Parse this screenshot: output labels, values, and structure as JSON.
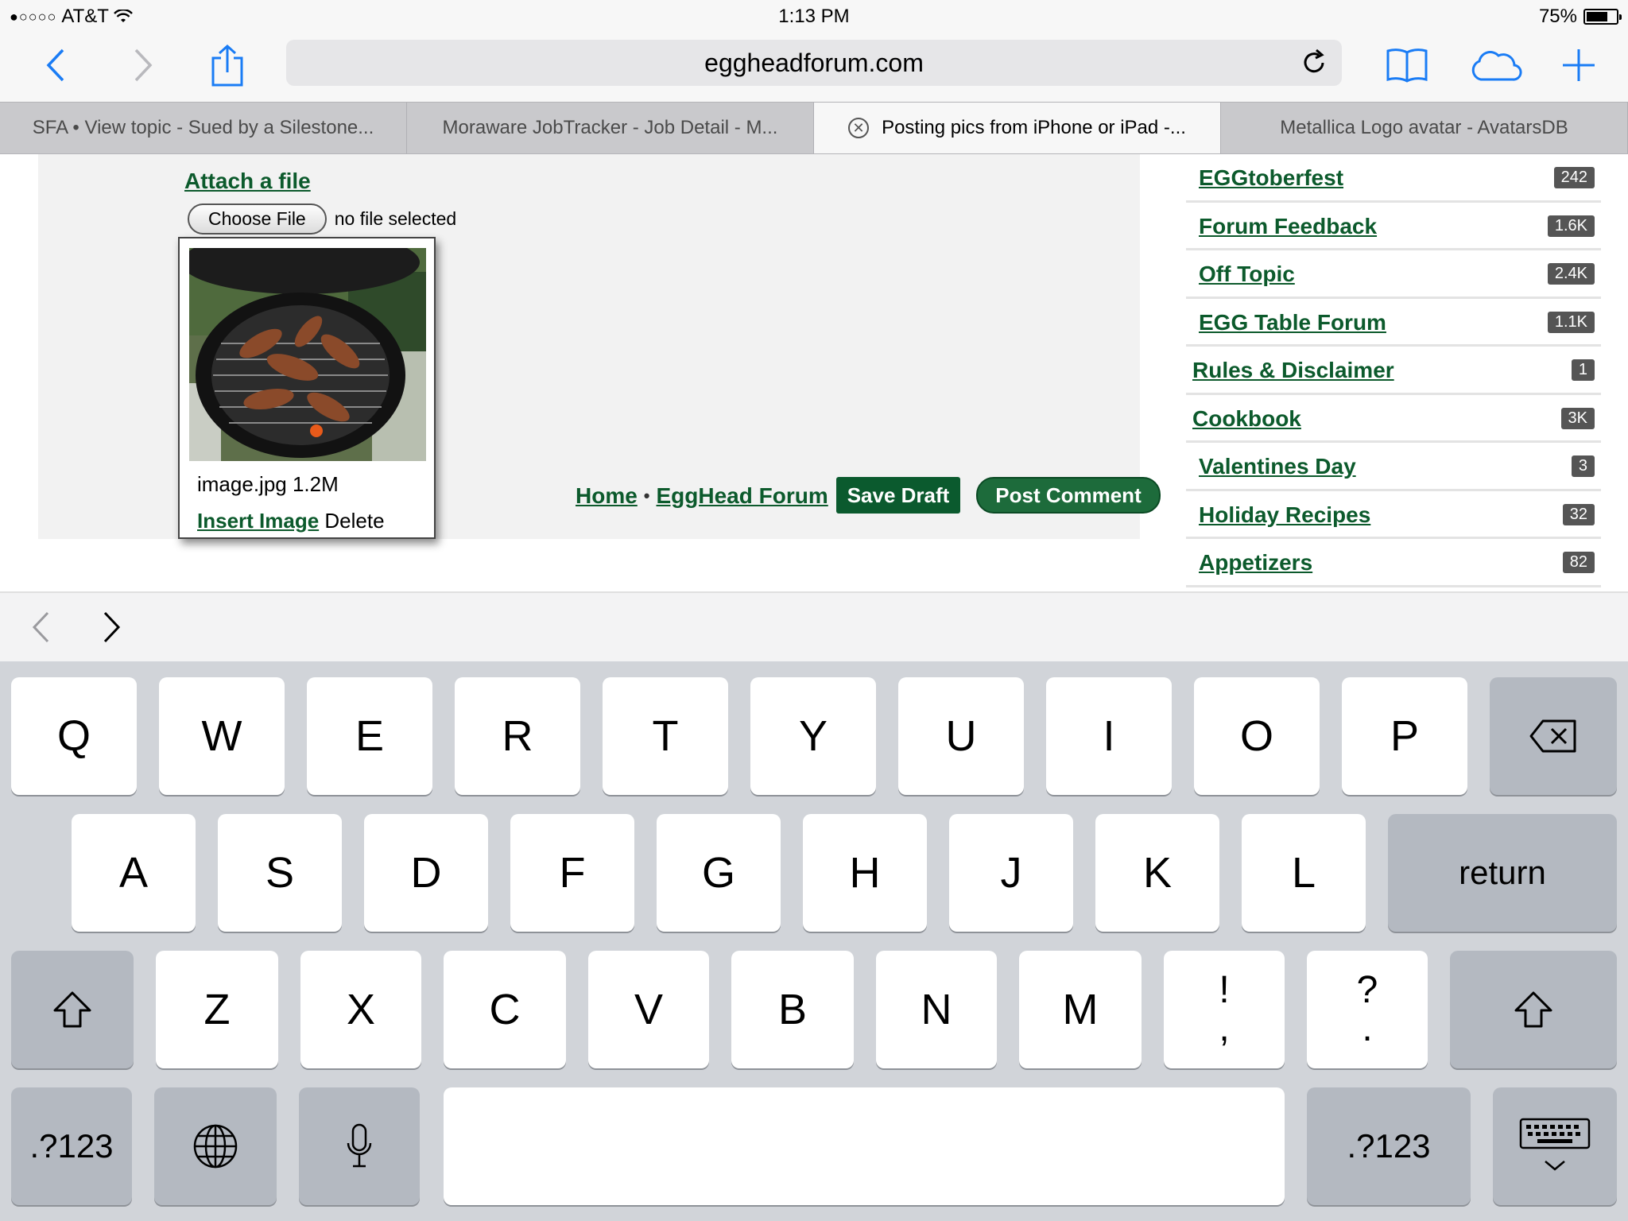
{
  "status_bar": {
    "signal": "●○○○○",
    "carrier": "AT&T",
    "time": "1:13 PM",
    "battery": "75%",
    "battery_level": 0.75
  },
  "browser": {
    "url": "eggheadforum.com",
    "tabs": [
      {
        "label": "SFA • View topic - Sued by a Silestone...",
        "active": false
      },
      {
        "label": "Moraware JobTracker - Job Detail - M...",
        "active": false
      },
      {
        "label": "Posting pics from iPhone or iPad -...",
        "active": true
      },
      {
        "label": "Metallica Logo avatar - AvatarsDB",
        "active": false
      }
    ]
  },
  "page": {
    "attach_label": "Attach a file",
    "choose_file_label": "Choose File",
    "no_file_text": "no file selected",
    "upload": {
      "filename": "image.jpg 1.2M",
      "insert_label": "Insert Image",
      "delete_label": "Delete"
    },
    "breadcrumb": {
      "home": "Home",
      "separator": "•",
      "forum": "EggHead Forum"
    },
    "save_draft_label": "Save Draft",
    "post_comment_label": "Post Comment",
    "categories": [
      {
        "name": "EGGtoberfest",
        "count": "242"
      },
      {
        "name": "Forum Feedback",
        "count": "1.6K"
      },
      {
        "name": "Off Topic",
        "count": "2.4K"
      },
      {
        "name": "EGG Table Forum",
        "count": "1.1K"
      },
      {
        "name": "Rules & Disclaimer",
        "count": "1"
      },
      {
        "name": "Cookbook",
        "count": "3K"
      },
      {
        "name": "Valentines Day",
        "count": "3"
      },
      {
        "name": "Holiday Recipes",
        "count": "32"
      },
      {
        "name": "Appetizers",
        "count": "82"
      }
    ]
  },
  "keyboard": {
    "row1": [
      "Q",
      "W",
      "E",
      "R",
      "T",
      "Y",
      "U",
      "I",
      "O",
      "P"
    ],
    "row2": [
      "A",
      "S",
      "D",
      "F",
      "G",
      "H",
      "J",
      "K",
      "L"
    ],
    "row3": [
      "Z",
      "X",
      "C",
      "V",
      "B",
      "N",
      "M"
    ],
    "punct1": {
      "top": "!",
      "bottom": ","
    },
    "punct2": {
      "top": "?",
      "bottom": "."
    },
    "return_label": "return",
    "numbers_label": ".?123"
  },
  "colors": {
    "accent": "#1a7cf5",
    "forum_green": "#0c5a2c",
    "badge": "#555555",
    "keyboard_bg": "#d1d4d9"
  }
}
